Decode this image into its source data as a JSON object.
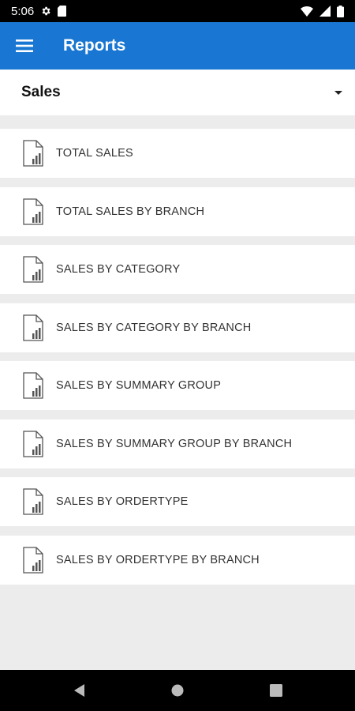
{
  "status_bar": {
    "time": "5:06",
    "icons": [
      "settings-gear-icon",
      "sim-card-icon",
      "wifi-icon",
      "signal-icon",
      "battery-icon"
    ]
  },
  "app_bar": {
    "menu_icon": "hamburger-menu-icon",
    "title": "Reports",
    "color": "#1976d2"
  },
  "category_select": {
    "selected": "Sales",
    "icon": "dropdown-arrow-icon"
  },
  "reports": [
    {
      "label": "TOTAL SALES",
      "icon": "report-chart-icon"
    },
    {
      "label": "TOTAL SALES BY BRANCH",
      "icon": "report-chart-icon"
    },
    {
      "label": "SALES BY CATEGORY",
      "icon": "report-chart-icon"
    },
    {
      "label": "SALES BY CATEGORY BY BRANCH",
      "icon": "report-chart-icon"
    },
    {
      "label": "SALES BY SUMMARY GROUP",
      "icon": "report-chart-icon"
    },
    {
      "label": "SALES BY SUMMARY GROUP BY BRANCH",
      "icon": "report-chart-icon"
    },
    {
      "label": "SALES BY ORDERTYPE",
      "icon": "report-chart-icon"
    },
    {
      "label": "SALES BY ORDERTYPE BY BRANCH",
      "icon": "report-chart-icon"
    }
  ],
  "nav_bar": {
    "buttons": [
      "back-icon",
      "home-icon",
      "recents-icon"
    ]
  }
}
